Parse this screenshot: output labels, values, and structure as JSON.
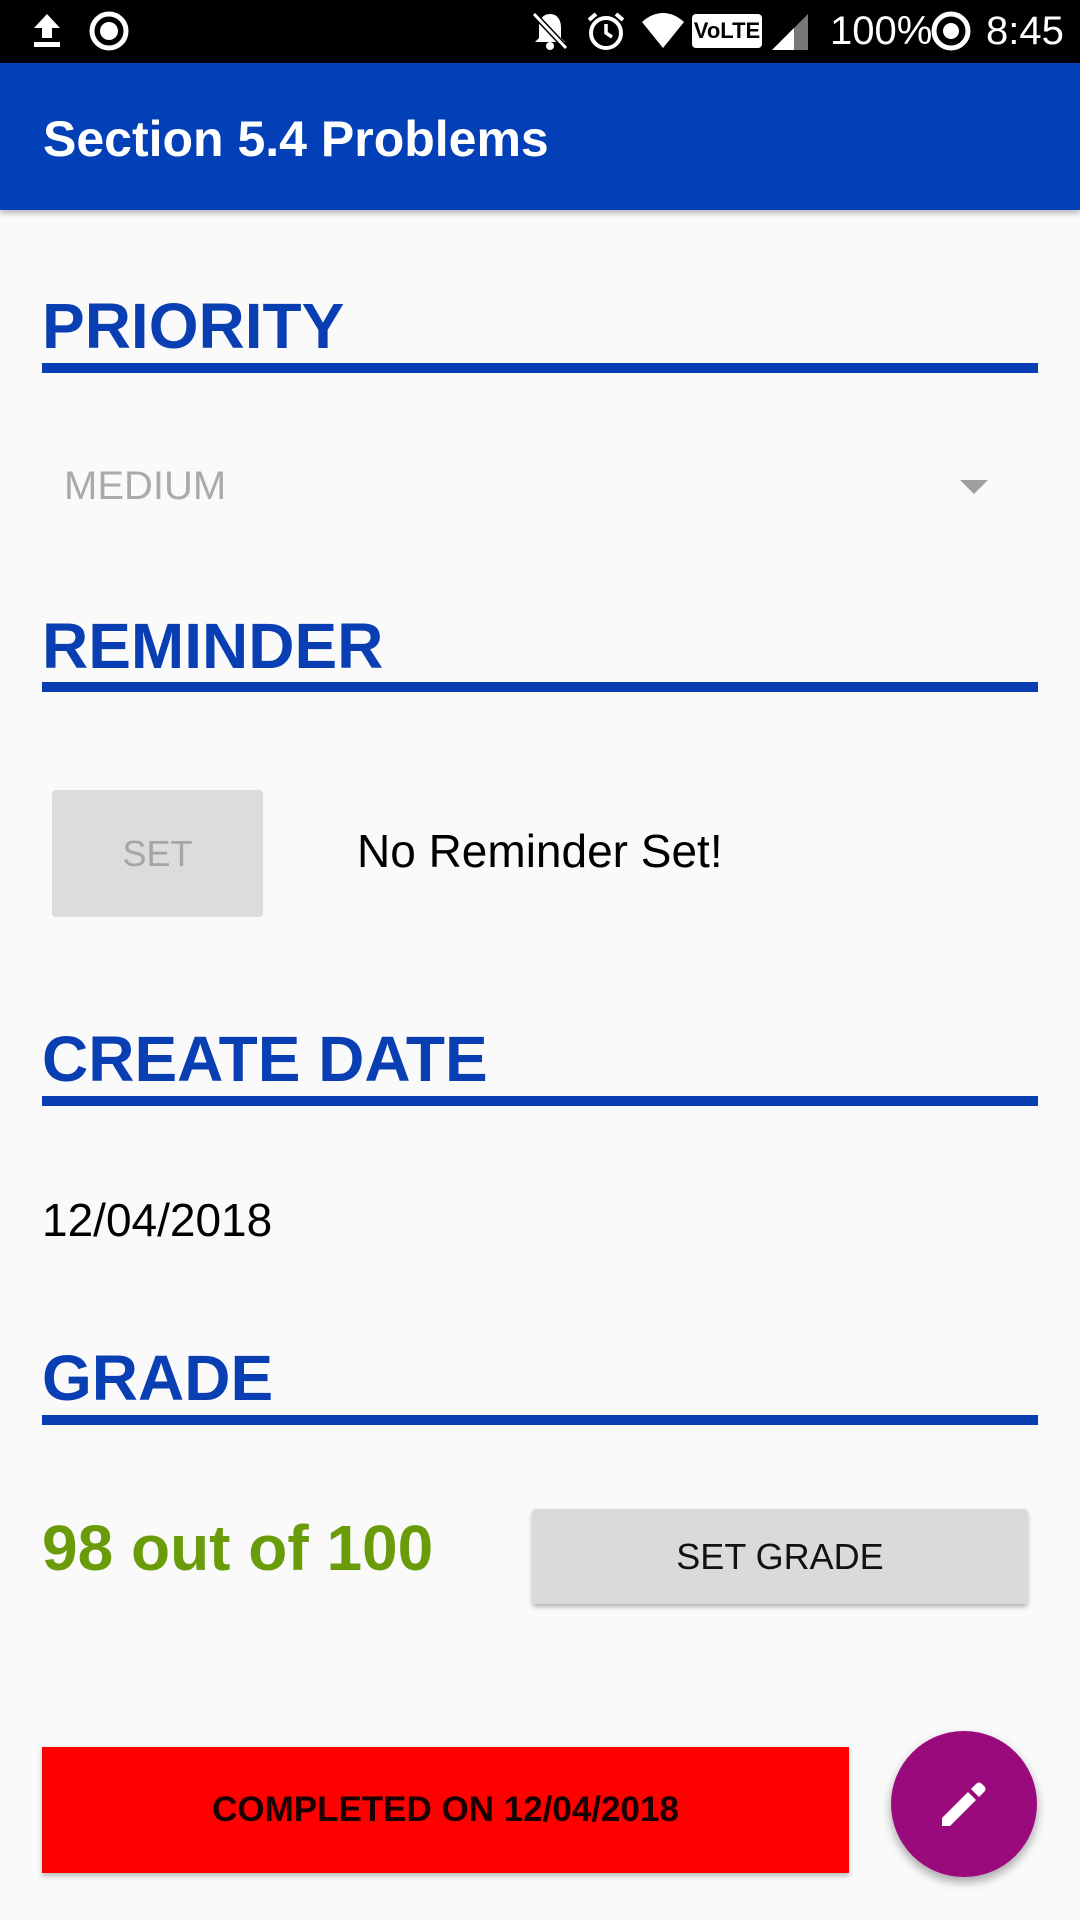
{
  "status_bar": {
    "battery_percent": "100%",
    "time": "8:45",
    "volte_label": "VoLTE",
    "icons": [
      "upload-icon",
      "record-icon",
      "bell-off-icon",
      "alarm-icon",
      "wifi-icon",
      "volte-icon",
      "signal-icon",
      "battery-saver-icon"
    ]
  },
  "app_bar": {
    "title": "Section 5.4 Problems",
    "color": "#0340b8"
  },
  "sections": {
    "priority": {
      "header": "PRIORITY",
      "selected_value": "MEDIUM"
    },
    "reminder": {
      "header": "REMINDER",
      "set_label": "SET",
      "status_text": "No Reminder Set!"
    },
    "create_date": {
      "header": "CREATE DATE",
      "value": "12/04/2018"
    },
    "grade": {
      "header": "GRADE",
      "value_text": "98 out of 100",
      "set_grade_label": "SET GRADE"
    }
  },
  "completed_banner": {
    "label": "COMPLETED ON 12/04/2018",
    "color": "#ff0000"
  },
  "fab": {
    "icon": "edit-icon",
    "color": "#9b0a7d"
  },
  "colors": {
    "accent_blue": "#0a3fb3",
    "grade_green": "#6a9c0a"
  }
}
